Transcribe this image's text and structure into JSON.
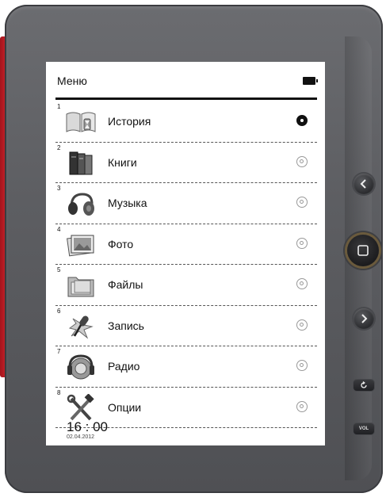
{
  "header": {
    "title": "Меню",
    "battery_icon": "battery-icon"
  },
  "menu": {
    "items": [
      {
        "number": "1",
        "label": "История",
        "icon": "history-book-icon",
        "selected": true
      },
      {
        "number": "2",
        "label": "Книги",
        "icon": "books-icon",
        "selected": false
      },
      {
        "number": "3",
        "label": "Музыка",
        "icon": "headphones-icon",
        "selected": false
      },
      {
        "number": "4",
        "label": "Фото",
        "icon": "photo-icon",
        "selected": false
      },
      {
        "number": "5",
        "label": "Файлы",
        "icon": "folder-icon",
        "selected": false
      },
      {
        "number": "6",
        "label": "Запись",
        "icon": "microphone-icon",
        "selected": false
      },
      {
        "number": "7",
        "label": "Радио",
        "icon": "radio-icon",
        "selected": false
      },
      {
        "number": "8",
        "label": "Опции",
        "icon": "tools-icon",
        "selected": false
      }
    ]
  },
  "footer": {
    "time": "16 : 00",
    "date": "02.04.2012"
  },
  "hardware": {
    "vol_label": "VOL"
  },
  "colors": {
    "bezel": "#5d5e62",
    "cover": "#c8222a",
    "screen": "#ffffff",
    "ink": "#111111"
  }
}
